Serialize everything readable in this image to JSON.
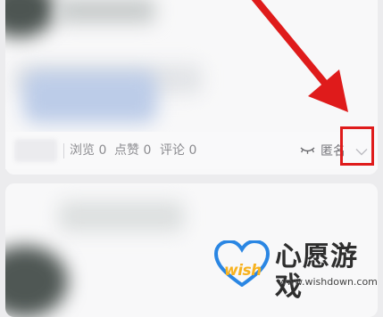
{
  "post_stats": {
    "views_label": "浏览",
    "views_count": "0",
    "likes_label": "点赞",
    "likes_count": "0",
    "comments_label": "评论",
    "comments_count": "0",
    "anonymous_label": "匿名",
    "anonymous_icon": "eye-closed-icon",
    "dropdown_icon": "chevron-down-icon"
  },
  "annotation": {
    "highlight_color": "#df1b1b"
  },
  "watermark": {
    "logo_text": "wish",
    "brand_name": "心愿游戏",
    "url": "www.wishdown.com"
  }
}
